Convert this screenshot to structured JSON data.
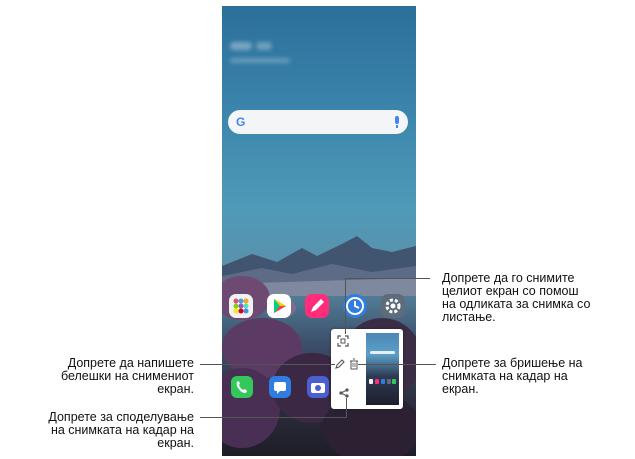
{
  "search": {
    "logo": "G",
    "mic_icon": "mic-icon"
  },
  "home_apps": [
    "app-grid-icon",
    "play-store-icon",
    "memo-icon",
    "clock-icon",
    "settings-icon"
  ],
  "dock_apps": [
    "phone-icon",
    "messages-icon",
    "camera-icon"
  ],
  "popup": {
    "buttons": [
      "scroll-capture-icon",
      "pencil-icon",
      "trash-icon",
      "share-icon"
    ]
  },
  "callouts": {
    "top_right": [
      "Допрете да го снимите",
      "целиот екран со помош",
      "на одликата за снимка со",
      "листање."
    ],
    "mid_right": [
      "Допрете за бришење на",
      "снимката на кадар на",
      "екран."
    ],
    "mid_left": [
      "Допрете да напишете",
      "белешки на снимениот",
      "екран."
    ],
    "bottom_left": [
      "Допрете за споделување",
      "на снимката на кадар на",
      "екран."
    ]
  },
  "colors": {
    "accent": "#4285f4",
    "callout_text": "#111111",
    "line": "#555555"
  }
}
